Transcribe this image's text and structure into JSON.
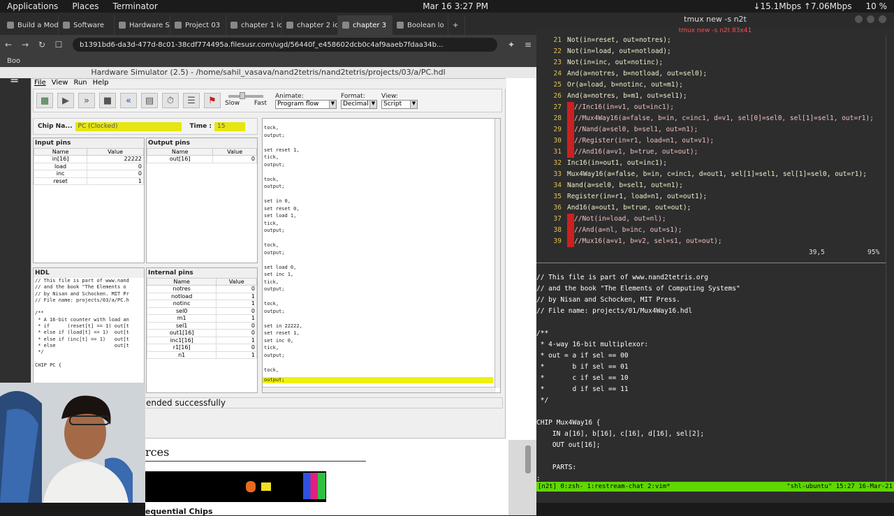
{
  "topbar": {
    "applications": "Applications",
    "places": "Places",
    "terminator": "Terminator",
    "datetime": "Mar 16  3:27 PM",
    "network": "↓15.1Mbps ↑7.06Mbps",
    "battery": "10 %"
  },
  "browser": {
    "tabs": [
      "Build a Mod",
      "Software",
      "Hardware S",
      "Project 03",
      "chapter 1 ic",
      "chapter 2 ic",
      "chapter 3",
      "Boolean lo"
    ],
    "active_tab_index": 6,
    "url": "b1391bd6-da3d-477d-8c01-38cdf774495a.filesusr.com/ugd/56440f_e458602dcb0c4af9aaeb7fdaa34b...",
    "bookmark": "Boo",
    "page_heading": "rces",
    "page_subheading": "equential Chips"
  },
  "hw": {
    "title": "Hardware Simulator (2.5) - /home/sahil_vasava/nand2tetris/nand2tetris/projects/03/a/PC.hdl",
    "menu": [
      "File",
      "View",
      "Run",
      "Help"
    ],
    "slow": "Slow",
    "fast": "Fast",
    "animate_label": "Animate:",
    "animate_value": "Program flow",
    "format_label": "Format:",
    "format_value": "Decimal",
    "view_label": "View:",
    "view_value": "Script",
    "chip_name_label": "Chip Na...",
    "chip_name": "PC (Clocked)",
    "time_label": "Time :",
    "time_value": "15",
    "input_pins_title": "Input pins",
    "output_pins_title": "Output pins",
    "hdl_title": "HDL",
    "internal_pins_title": "Internal pins",
    "col_name": "Name",
    "col_value": "Value",
    "input_pins": [
      [
        "in[16]",
        "22222"
      ],
      [
        "load",
        "0"
      ],
      [
        "inc",
        "0"
      ],
      [
        "reset",
        "1"
      ]
    ],
    "output_pins": [
      [
        "out[16]",
        "0"
      ]
    ],
    "internal_pins": [
      [
        "notres",
        "0"
      ],
      [
        "notload",
        "1"
      ],
      [
        "notinc",
        "1"
      ],
      [
        "sel0",
        "0"
      ],
      [
        "m1",
        "1"
      ],
      [
        "sel1",
        "0"
      ],
      [
        "out1[16]",
        "0"
      ],
      [
        "inc1[16]",
        "1"
      ],
      [
        "r1[16]",
        "0"
      ],
      [
        "n1",
        "1"
      ]
    ],
    "hdl_text": "// This file is part of www.nand\n// and the book \"The Elements o\n// by Nisan and Schocken. MIT Pr\n// File name: projects/03/a/PC.h\n\n/**\n * A 16-bit counter with load an\n * if      (reset[t] == 1) out[t\n * else if (load[t] == 1)  out[t\n * else if (inc[t] == 1)   out[t\n * else                    out[t\n */\n\nCHIP PC {",
    "script_text": "tock,\noutput;\n\nset reset 1,\ntick,\noutput;\n\ntock,\noutput;\n\nset in 0,\nset reset 0,\nset load 1,\ntick,\noutput;\n\ntock,\noutput;\n\nset load 0,\nset inc 1,\ntick,\noutput;\n\ntock,\noutput;\n\nset in 22222,\nset reset 1,\nset inc 0,\ntick,\noutput;\n\ntock,",
    "script_highlight": "output;",
    "status": "ended successfully"
  },
  "terminal": {
    "title": "tmux new -s n2t",
    "subtitle": "tmux new -s n2t 83x41",
    "vim_lines": [
      [
        "21",
        "Not(in=reset, out=notres);",
        ""
      ],
      [
        "22",
        "Not(in=load, out=notload);",
        ""
      ],
      [
        "23",
        "Not(in=inc, out=notinc);",
        ""
      ],
      [
        "24",
        "And(a=notres, b=notload, out=sel0);",
        ""
      ],
      [
        "25",
        "Or(a=load, b=notinc, out=m1);",
        ""
      ],
      [
        "26",
        "And(a=notres, b=m1, out=sel1);",
        ""
      ],
      [
        "27",
        "//Inc16(in=v1, out=inc1);",
        "c"
      ],
      [
        "28",
        "//Mux4Way16(a=false, b=in, c=inc1, d=v1, sel[0]=sel0, sel[1]=sel1, out=r1);",
        "c"
      ],
      [
        "29",
        "//Nand(a=sel0, b=sel1, out=n1);",
        "c"
      ],
      [
        "30",
        "//Register(in=r1, load=n1, out=v1);",
        "c"
      ],
      [
        "31",
        "//And16(a=v1, b=true, out=out);",
        "c"
      ],
      [
        "32",
        "Inc16(in=out1, out=inc1);",
        ""
      ],
      [
        "33",
        "Mux4Way16(a=false, b=in, c=inc1, d=out1, sel[1]=sel1, sel[1]=sel0, out=r1);",
        ""
      ],
      [
        "34",
        "Nand(a=sel0, b=sel1, out=n1);",
        ""
      ],
      [
        "35",
        "Register(in=r1, load=n1, out=out1);",
        ""
      ],
      [
        "36",
        "And16(a=out1, b=true, out=out);",
        ""
      ],
      [
        "37",
        "//Not(in=load, out=nl);",
        "c"
      ],
      [
        "38",
        "//And(a=nl, b=inc, out=s1);",
        "c"
      ],
      [
        "39",
        "//Mux16(a=v1, b=v2, sel=s1, out=out);",
        "c"
      ]
    ],
    "vim_position": "39,5",
    "vim_percent": "95%",
    "lower_lines": [
      "// This file is part of www.nand2tetris.org",
      "// and the book \"The Elements of Computing Systems\"",
      "// by Nisan and Schocken, MIT Press.",
      "// File name: projects/01/Mux4Way16.hdl",
      "",
      "/**",
      " * 4-way 16-bit multiplexor:",
      " * out = a if sel == 00",
      " *       b if sel == 01",
      " *       c if sel == 10",
      " *       d if sel == 11",
      " */",
      "",
      "CHIP Mux4Way16 {",
      "    IN a[16], b[16], c[16], d[16], sel[2];",
      "    OUT out[16];",
      "",
      "    PARTS:",
      ":"
    ],
    "tmux_left": "[n2t] 0:zsh- 1:restream-chat  2:vim*",
    "tmux_right": "\"shl-ubuntu\" 15:27 16-Mar-21"
  }
}
